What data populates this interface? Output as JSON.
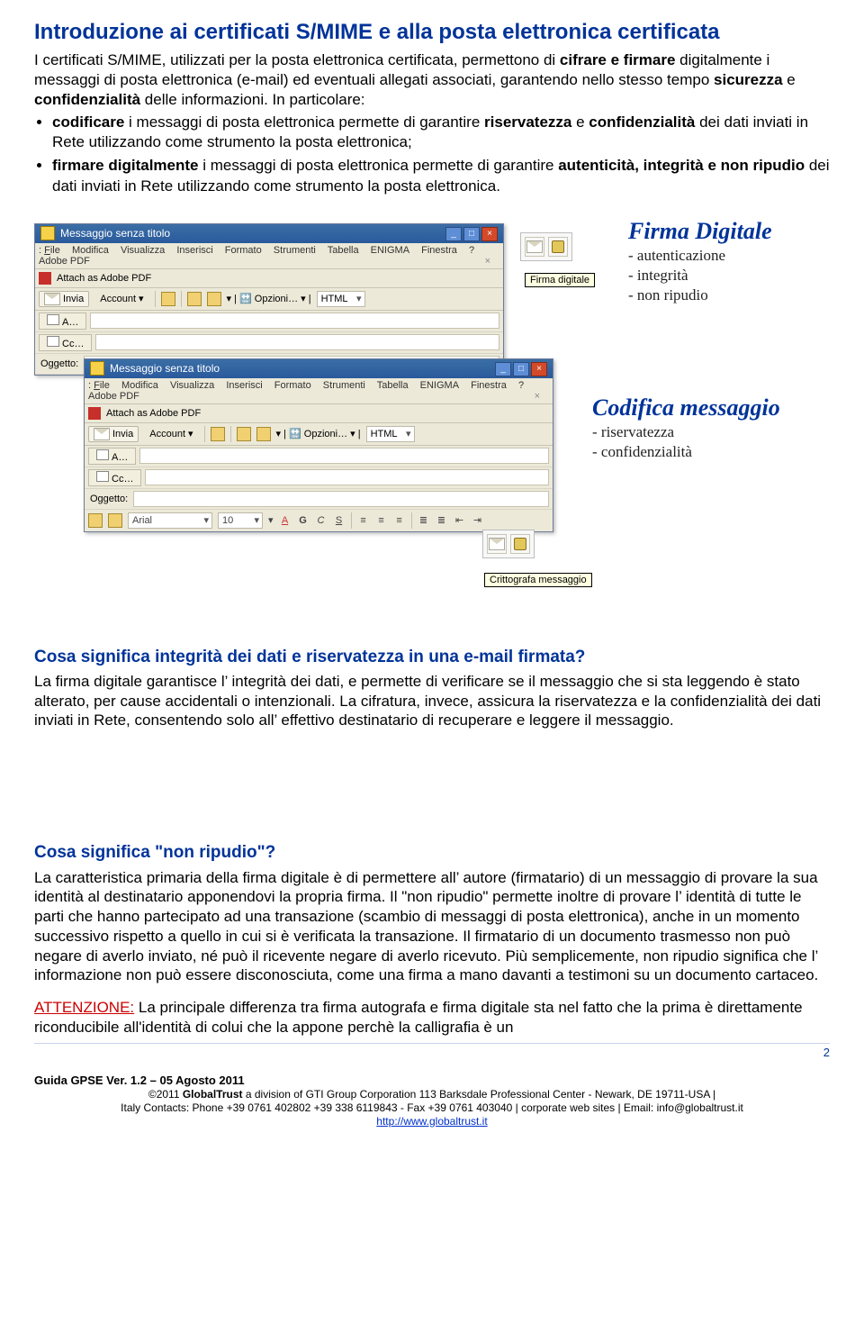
{
  "title": "Introduzione ai certificati S/MIME e alla posta elettronica certificata",
  "intro": {
    "p1a": "I certificati S/MIME, utilizzati per la posta elettronica certificata, permettono di ",
    "p1b": "cifrare e firmare",
    "p1c": " digitalmente i messaggi di posta elettronica (e-mail) ed eventuali allegati associati, garantendo nello stesso tempo ",
    "p1d": "sicurezza",
    "p1e": " e ",
    "p1f": "confidenzialità",
    "p1g": " delle informazioni. In particolare:"
  },
  "bullets": {
    "b1a": "codificare",
    "b1b": " i messaggi di posta elettronica permette di garantire ",
    "b1c": "riservatezza",
    "b1d": " e ",
    "b1e": "confidenzialità",
    "b1f": " dei dati inviati in Rete utilizzando come strumento la posta elettronica;",
    "b2a": "firmare digitalmente",
    "b2b": " i messaggi di posta elettronica permette di garantire ",
    "b2c": "autenticità, integrità e non ripudio",
    "b2d": " dei dati inviati in Rete utilizzando come strumento la posta elettronica."
  },
  "figure": {
    "win_title": "Messaggio senza titolo",
    "menu": {
      "file": "File",
      "mod": "Modifica",
      "vis": "Visualizza",
      "ins": "Inserisci",
      "fmt": "Formato",
      "str": "Strumenti",
      "tab": "Tabella",
      "eni": "ENIGMA",
      "fin": "Finestra",
      "que": "?",
      "adobe": "Adobe PDF"
    },
    "toolbar": {
      "attach": "Attach as Adobe PDF",
      "invia": "Invia",
      "account": "Account",
      "opzioni": "Opzioni…",
      "html": "HTML"
    },
    "fields": {
      "a": "A…",
      "cc": "Cc…",
      "ogg": "Oggetto:"
    },
    "fmtbar": {
      "font": "Arial",
      "size": "10"
    },
    "tooltip1": "Firma digitale",
    "tooltip2": "Crittografa messaggio",
    "label1_title": "Firma Digitale",
    "label1_l1": "- autenticazione",
    "label1_l2": "- integrità",
    "label1_l3": "- non ripudio",
    "label2_title": "Codifica messaggio",
    "label2_l1": "- riservatezza",
    "label2_l2": "- confidenzialità"
  },
  "sec2": {
    "head": "Cosa significa integrità dei dati e riservatezza in una e-mail firmata?",
    "body": "La firma digitale garantisce l’ integrità dei dati, e permette di verificare se il messaggio che si sta leggendo è stato alterato, per cause accidentali o intenzionali. La cifratura, invece, assicura la riservatezza e la confidenzialità dei dati inviati in Rete, consentendo solo all’ effettivo destinatario di recuperare e leggere il messaggio."
  },
  "sec3": {
    "head": "Cosa significa \"non ripudio\"?",
    "body": "La caratteristica primaria della firma digitale è di permettere all’ autore (firmatario) di un messaggio di provare la sua identità al destinatario apponendovi la propria firma. Il \"non ripudio\" permette inoltre di provare l’ identità di tutte le parti che hanno partecipato ad una transazione (scambio di messaggi di posta elettronica), anche in un momento successivo rispetto a quello in cui si è verificata la transazione. Il firmatario di un documento trasmesso non può negare di averlo inviato, né può il ricevente negare di averlo ricevuto. Più semplicemente, non ripudio significa che l’ informazione non può essere disconosciuta, come una firma a mano davanti a testimoni su un documento cartaceo."
  },
  "attn": {
    "label": "ATTENZIONE:",
    "body": " La principale differenza tra firma autografa e firma digitale sta nel fatto che la prima è direttamente riconducibile all'identità di colui che la appone perchè la calligrafia è un"
  },
  "page_num": "2",
  "footer": {
    "l1a": "Guida GPSE Ver. 1.2 – 05 Agosto 2011",
    "l2a": "©2011 ",
    "l2b": "GlobalTrust",
    "l2c": " a division of GTI Group Corporation 113 Barksdale Professional Center - Newark, DE 19711-USA |",
    "l3": "Italy Contacts: Phone +39 0761 402802  +39 338 6119843 - Fax +39 0761 403040 | corporate web sites  |  Email: info@globaltrust.it",
    "l4": "http://www.globaltrust.it"
  }
}
